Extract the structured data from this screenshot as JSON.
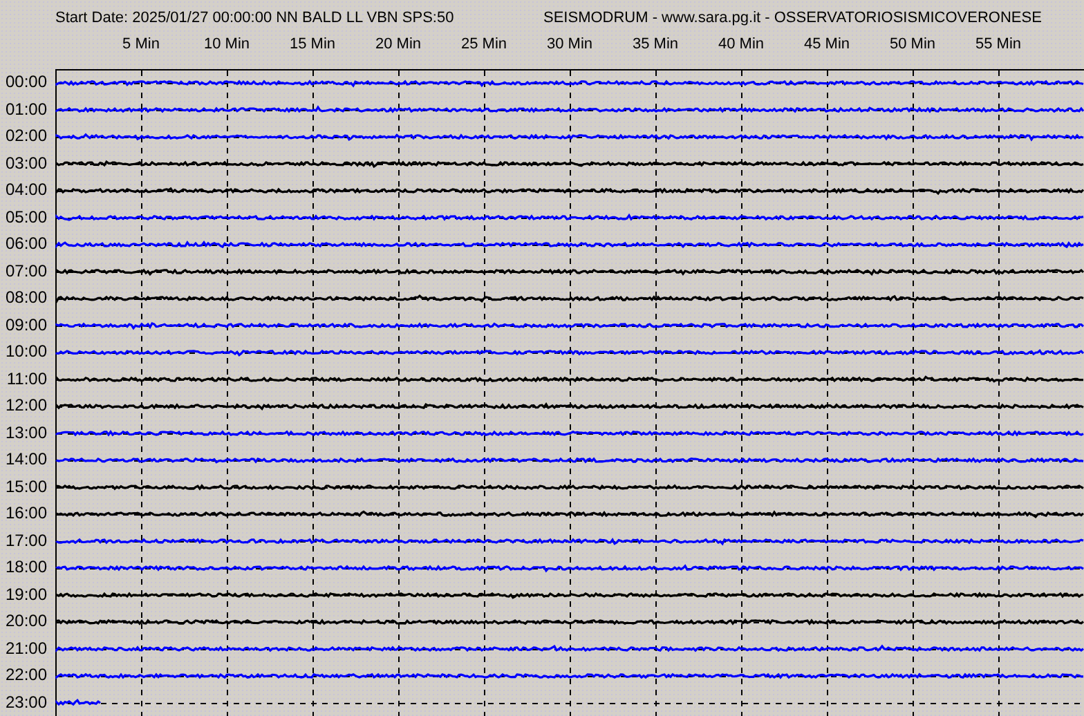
{
  "header": {
    "title": "Start Date: 2025/01/27 00:00:00 NN BALD LL VBN SPS:50",
    "source": "SEISMODRUM - www.sara.pg.it - OSSERVATORIOSISMICOVERONESE"
  },
  "minute_labels": [
    "5 Min",
    "10 Min",
    "15 Min",
    "20 Min",
    "25 Min",
    "30 Min",
    "35 Min",
    "40 Min",
    "45 Min",
    "50 Min",
    "55 Min"
  ],
  "rows": [
    {
      "hour": "00:00",
      "color": "#0000ff",
      "level": 1
    },
    {
      "hour": "01:00",
      "color": "#0000ff",
      "level": 1
    },
    {
      "hour": "02:00",
      "color": "#0000ff",
      "level": 1
    },
    {
      "hour": "03:00",
      "color": "#000000",
      "level": 1
    },
    {
      "hour": "04:00",
      "color": "#000000",
      "level": 1
    },
    {
      "hour": "05:00",
      "color": "#0000ff",
      "level": 1
    },
    {
      "hour": "06:00",
      "color": "#0000ff",
      "level": 1
    },
    {
      "hour": "07:00",
      "color": "#000000",
      "level": 1
    },
    {
      "hour": "08:00",
      "color": "#000000",
      "level": 1
    },
    {
      "hour": "09:00",
      "color": "#0000ff",
      "level": 1
    },
    {
      "hour": "10:00",
      "color": "#0000ff",
      "level": 1
    },
    {
      "hour": "11:00",
      "color": "#000000",
      "level": 1
    },
    {
      "hour": "12:00",
      "color": "#000000",
      "level": 1
    },
    {
      "hour": "13:00",
      "color": "#0000ff",
      "level": 1
    },
    {
      "hour": "14:00",
      "color": "#0000ff",
      "level": 1
    },
    {
      "hour": "15:00",
      "color": "#000000",
      "level": 1
    },
    {
      "hour": "16:00",
      "color": "#000000",
      "level": 1
    },
    {
      "hour": "17:00",
      "color": "#0000ff",
      "level": 1
    },
    {
      "hour": "18:00",
      "color": "#0000ff",
      "level": 1
    },
    {
      "hour": "19:00",
      "color": "#000000",
      "level": 1
    },
    {
      "hour": "20:00",
      "color": "#000000",
      "level": 1
    },
    {
      "hour": "21:00",
      "color": "#0000ff",
      "level": 1
    },
    {
      "hour": "22:00",
      "color": "#0000ff",
      "level": 1
    },
    {
      "hour": "23:00",
      "color": "#0000ff",
      "level": 0.045
    }
  ]
}
